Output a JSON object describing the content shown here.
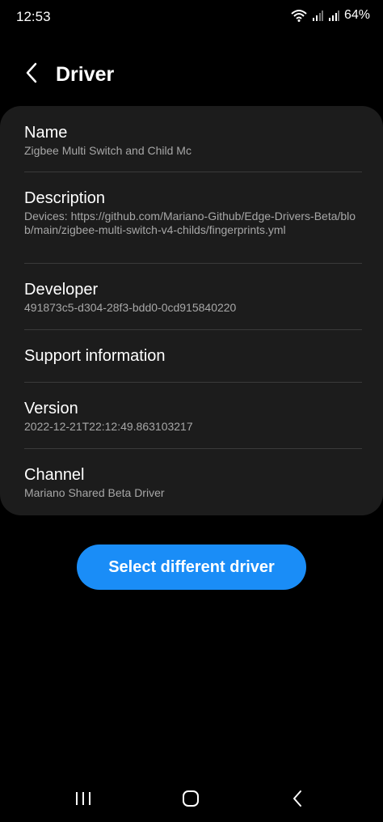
{
  "status": {
    "time": "12:53",
    "battery": "64%",
    "icons": [
      "wifi-icon",
      "signal-icon",
      "signal-icon"
    ]
  },
  "header": {
    "title": "Driver",
    "back_icon": "chevron-left-icon"
  },
  "details": {
    "name": {
      "label": "Name",
      "value": "Zigbee Multi Switch and Child Mc"
    },
    "description": {
      "label": "Description",
      "value": "Devices: https://github.com/Mariano-Github/Edge-Drivers-Beta/blob/main/zigbee-multi-switch-v4-childs/fingerprints.yml"
    },
    "developer": {
      "label": "Developer",
      "value": "491873c5-d304-28f3-bdd0-0cd915840220"
    },
    "support": {
      "label": "Support information"
    },
    "version": {
      "label": "Version",
      "value": "2022-12-21T22:12:49.863103217"
    },
    "channel": {
      "label": "Channel",
      "value": "Mariano Shared Beta Driver"
    }
  },
  "actions": {
    "select_label": "Select different driver"
  },
  "navbar": {
    "icons": [
      "recent-apps-icon",
      "home-icon",
      "back-icon"
    ]
  },
  "colors": {
    "background": "#000000",
    "card": "#1c1c1c",
    "accent": "#1a8df7",
    "secondary_text": "#a7a7a7"
  }
}
